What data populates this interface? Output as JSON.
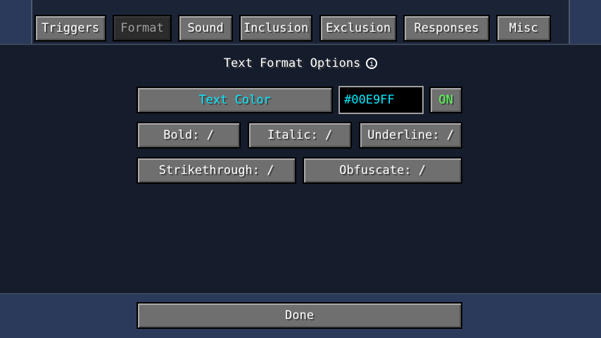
{
  "tabs": [
    {
      "label": "Triggers"
    },
    {
      "label": "Format"
    },
    {
      "label": "Sound"
    },
    {
      "label": "Inclusion"
    },
    {
      "label": "Exclusion"
    },
    {
      "label": "Responses"
    },
    {
      "label": "Misc"
    }
  ],
  "active_tab": "Format",
  "section": {
    "title": "Text Format Options",
    "info_icon": "ⓘ"
  },
  "text_color": {
    "label": "Text Color",
    "value": "#00E9FF",
    "toggle": "ON",
    "color": "#00e9ff"
  },
  "styles": {
    "bold": "Bold: /",
    "italic": "Italic: /",
    "underline": "Underline: /",
    "strikethrough": "Strikethrough: /",
    "obfuscate": "Obfuscate: /"
  },
  "footer": {
    "done_label": "Done"
  }
}
